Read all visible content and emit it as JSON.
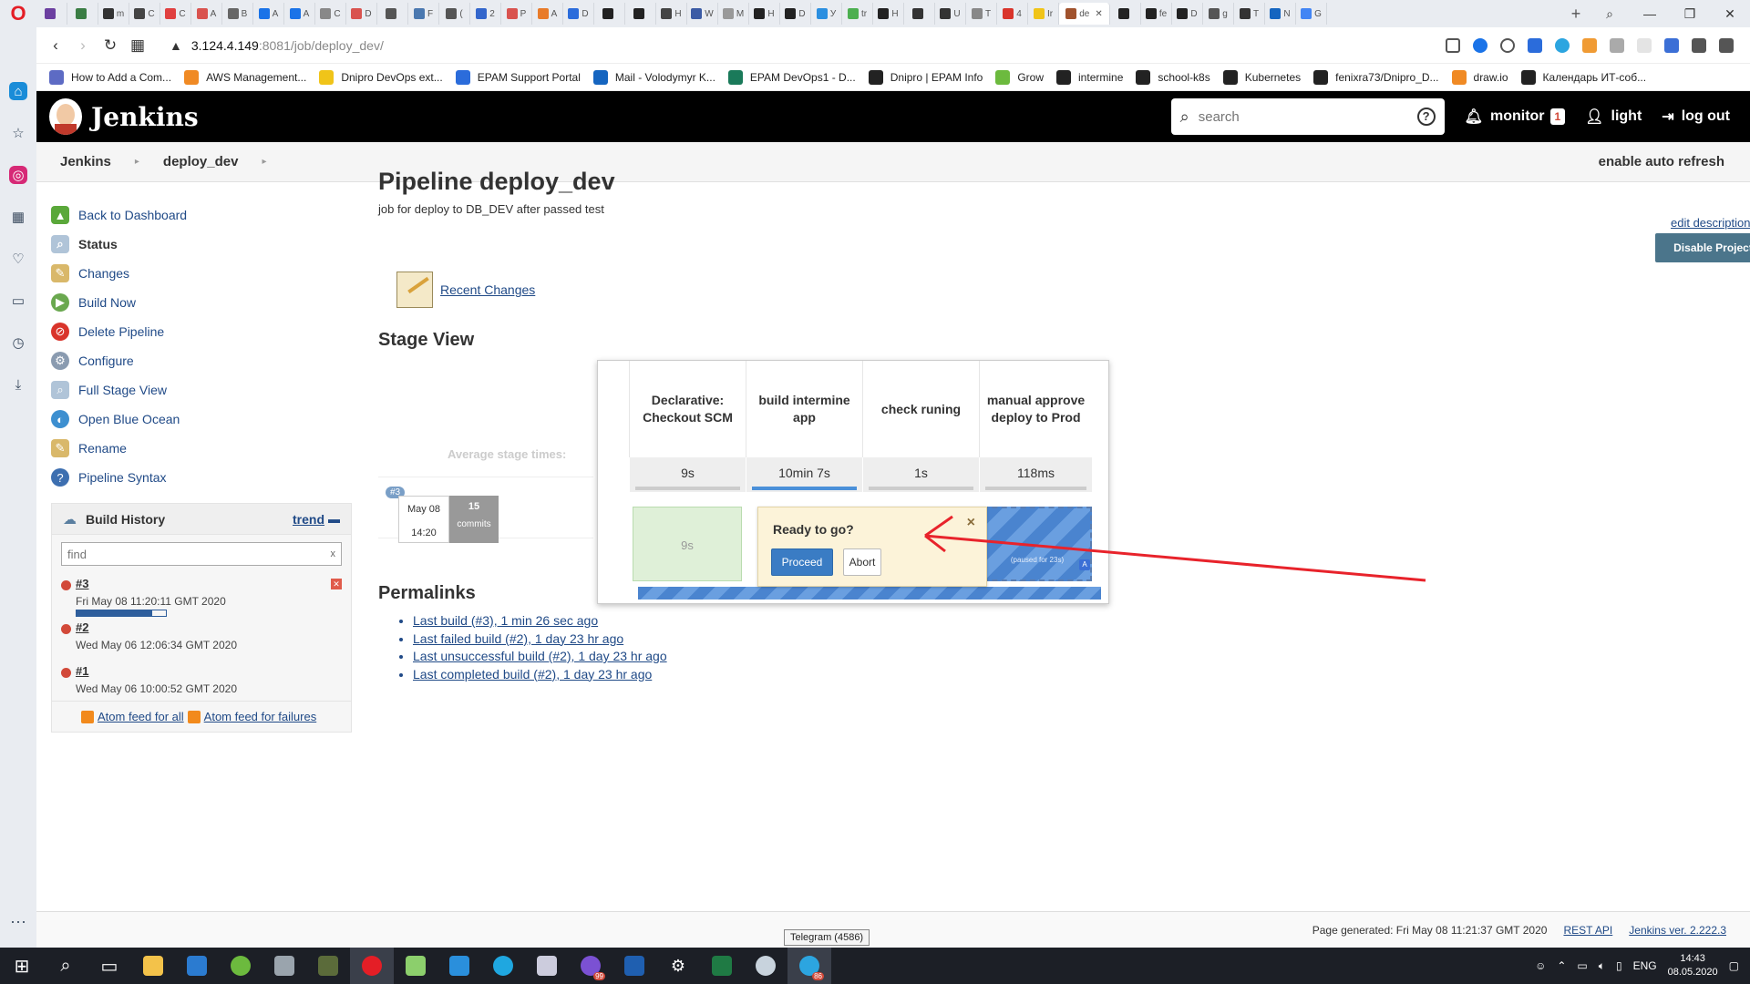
{
  "browser": {
    "tabs": [
      "",
      "",
      "m",
      "C",
      "C",
      "A",
      "B",
      "A",
      "A",
      "C",
      "D",
      "",
      "F",
      "(",
      "2",
      "P",
      "A",
      "D",
      "",
      "",
      "H",
      "W",
      "M",
      "H",
      "D",
      "У",
      "tr",
      "H",
      "",
      "U",
      "T",
      "4",
      "Ir",
      "de",
      "",
      "fe",
      "D",
      "g",
      "T",
      "N",
      "G"
    ],
    "active_tab_label": "de",
    "new_tab": "+",
    "url_host": "3.124.4.149",
    "url_port_path": ":8081/job/deploy_dev/",
    "bookmarks": [
      "How to Add a Com...",
      "AWS Management...",
      "Dnipro DevOps ext...",
      "EPAM Support Portal",
      "Mail - Volodymyr K...",
      "EPAM DevOps1 - D...",
      "Dnipro | EPAM Info",
      "Grow",
      "intermine",
      "school-k8s",
      "Kubernetes",
      "fenixra73/Dnipro_D...",
      "draw.io",
      "Календарь ИТ-соб..."
    ]
  },
  "jenkins": {
    "title": "Jenkins",
    "search_placeholder": "search",
    "help": "?",
    "monitor_label": "monitor",
    "monitor_count": "1",
    "theme_label": "light",
    "logout_label": "log out",
    "breadcrumbs": [
      "Jenkins",
      "deploy_dev"
    ],
    "auto_refresh": "enable auto refresh"
  },
  "tasks": [
    "Back to Dashboard",
    "Status",
    "Changes",
    "Build Now",
    "Delete Pipeline",
    "Configure",
    "Full Stage View",
    "Open Blue Ocean",
    "Rename",
    "Pipeline Syntax"
  ],
  "build_history": {
    "title": "Build History",
    "trend": "trend",
    "find_placeholder": "find",
    "clear": "x",
    "builds": [
      {
        "num": "#3",
        "date": "Fri May 08 11:20:11 GMT 2020",
        "status_color": "#d24939",
        "progress": 0.85
      },
      {
        "num": "#2",
        "date": "Wed May 06 12:06:34 GMT 2020",
        "status_color": "#d24939"
      },
      {
        "num": "#1",
        "date": "Wed May 06 10:00:52 GMT 2020",
        "status_color": "#d24939"
      }
    ],
    "feed_all": "Atom feed for all",
    "feed_failures": "Atom feed for failures"
  },
  "main": {
    "page_title": "Pipeline deploy_dev",
    "description": "job for deploy to DB_DEV after passed test",
    "edit_description": "edit description",
    "disable_project": "Disable Project",
    "recent_changes": "Recent Changes",
    "stage_view_title": "Stage View",
    "avg_label": "Average stage times:",
    "stages": [
      {
        "name": "Declarative: Checkout SCM",
        "avg": "9s",
        "result": "9s"
      },
      {
        "name": "build intermine app",
        "avg": "10min 7s",
        "result": ""
      },
      {
        "name": "check runing",
        "avg": "1s",
        "result": ""
      },
      {
        "name": "manual approve deploy to Prod",
        "avg": "118ms",
        "result": "(paused for 23s)"
      }
    ],
    "build_row": {
      "pill": "#3",
      "date": "May 08",
      "time": "14:20",
      "commits_num": "15",
      "commits_label": "commits"
    },
    "popup": {
      "question": "Ready to go?",
      "close": "×",
      "proceed": "Proceed",
      "abort": "Abort"
    },
    "permalinks_title": "Permalinks",
    "permalinks": [
      "Last build (#3), 1 min 26 sec ago",
      "Last failed build (#2), 1 day 23 hr ago",
      "Last unsuccessful build (#2), 1 day 23 hr ago",
      "Last completed build (#2), 1 day 23 hr ago"
    ]
  },
  "footer": {
    "generated": "Page generated: Fri May 08 11:21:37 GMT 2020",
    "rest_api": "REST API",
    "version": "Jenkins ver. 2.222.3"
  },
  "tooltip": "Telegram (4586)",
  "taskbar": {
    "lang": "ENG",
    "time": "14:43",
    "date": "08.05.2020",
    "badge_viber": "99",
    "badge_telegram": "86"
  },
  "colors": {
    "jenkins_black": "#000000",
    "link_blue": "#204a87",
    "run_blue": "#4a84cf",
    "success_green": "#dff0d8",
    "annotation_red": "#e8232b"
  }
}
